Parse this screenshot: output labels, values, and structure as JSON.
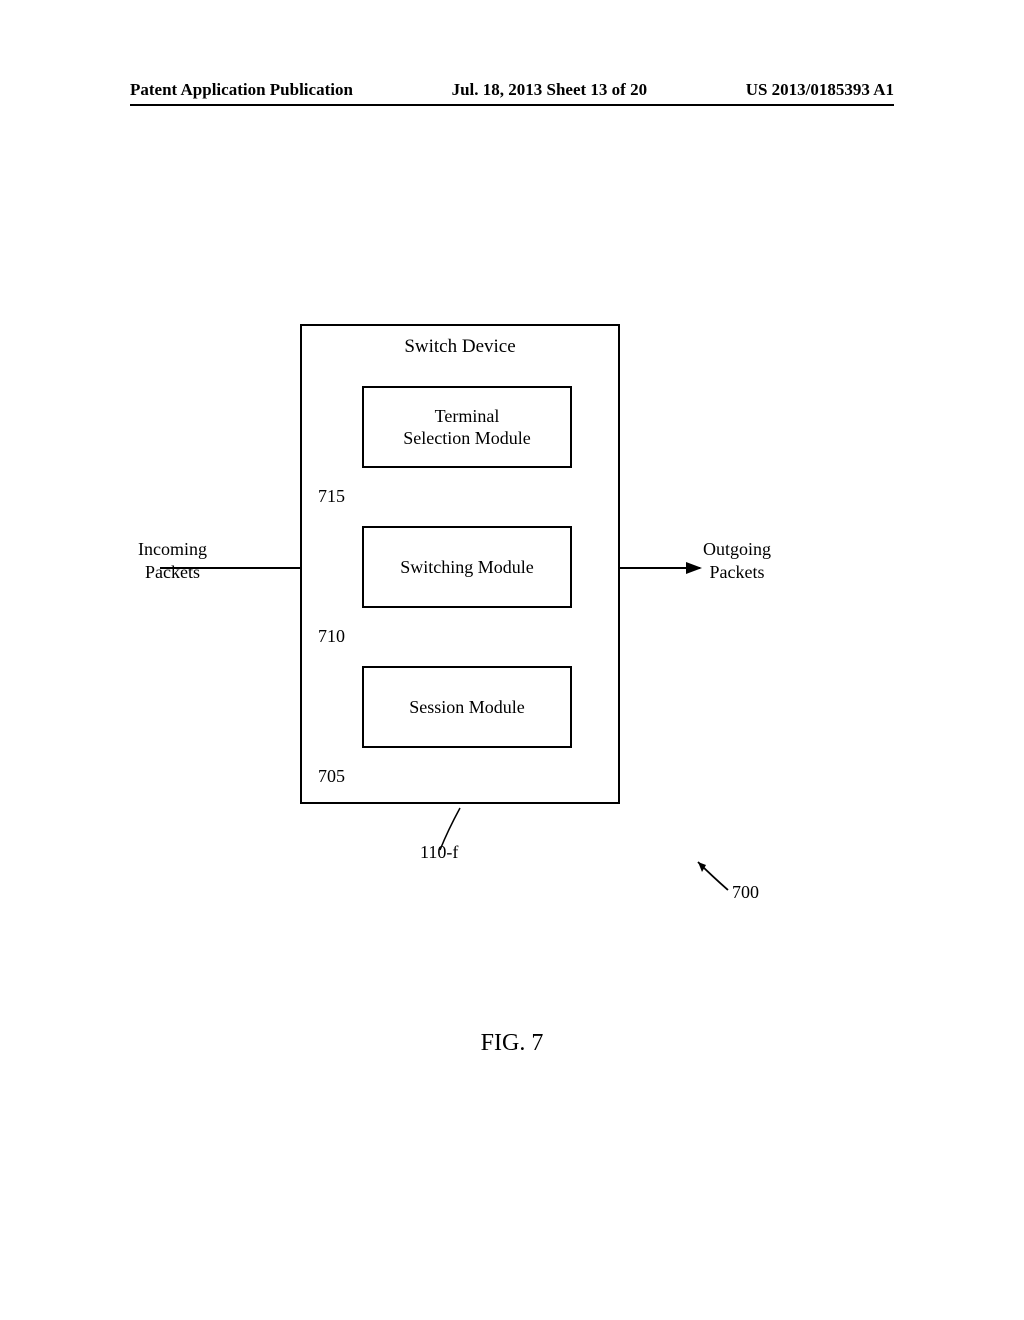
{
  "header": {
    "left": "Patent Application Publication",
    "center": "Jul. 18, 2013  Sheet 13 of 20",
    "right": "US 2013/0185393 A1"
  },
  "diagram": {
    "container_title": "Switch Device",
    "boxes": {
      "terminal_line1": "Terminal",
      "terminal_line2": "Selection Module",
      "switching": "Switching Module",
      "session": "Session Module"
    },
    "labels": {
      "ref715": "715",
      "ref710": "710",
      "ref705": "705",
      "ref110f": "110-f",
      "ref700": "700",
      "incoming_line1": "Incoming",
      "incoming_line2": "Packets",
      "outgoing_line1": "Outgoing",
      "outgoing_line2": "Packets"
    }
  },
  "figure_caption": "FIG. 7"
}
